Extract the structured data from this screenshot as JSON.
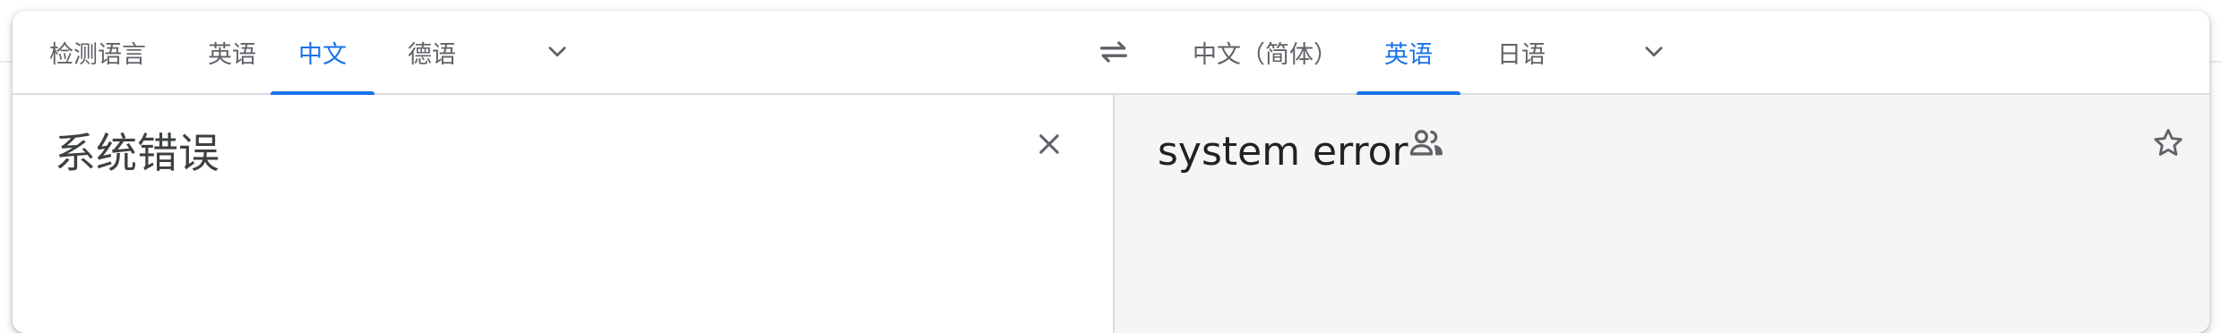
{
  "source_languages": {
    "tabs": [
      {
        "label": "检测语言"
      },
      {
        "label": "英语"
      },
      {
        "label": "中文"
      },
      {
        "label": "德语"
      }
    ],
    "active": "中文",
    "more_icon": "chevron-down-icon"
  },
  "swap_icon": "swap-arrows-icon",
  "target_languages": {
    "tabs": [
      {
        "label": "中文（简体）"
      },
      {
        "label": "英语"
      },
      {
        "label": "日语"
      }
    ],
    "active": "英语",
    "more_icon": "chevron-down-icon"
  },
  "source": {
    "text": "系统错误",
    "clear_icon": "close-icon"
  },
  "translation": {
    "text": "system error",
    "community_icon": "people-icon",
    "save_icon": "star-outline-icon"
  },
  "colors": {
    "accent": "#1a73e8",
    "tab_text": "#5f6368",
    "target_bg": "#f5f5f5"
  }
}
